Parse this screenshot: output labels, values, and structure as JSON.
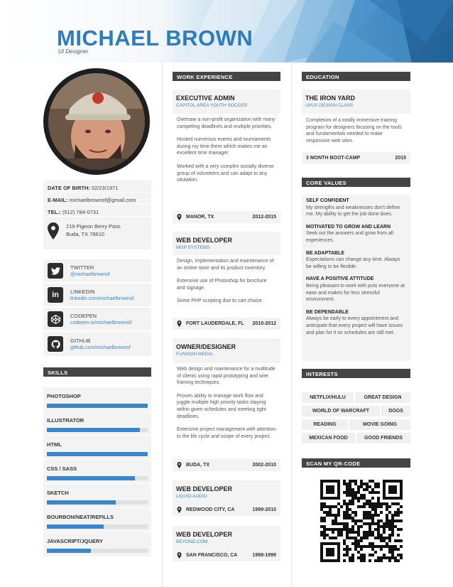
{
  "header": {
    "name": "MICHAEL BROWN",
    "role": "UI Designer"
  },
  "personal": {
    "dob_label": "DATE OF BIRTH:",
    "dob": "02/23/1971",
    "email_label": "E-MAIL:",
    "email": "michaelbrownsf@gmail.com",
    "tel_label": "TEL.:",
    "tel": "(512) 784-0731",
    "address_line1": "219 Pigeon Berry Pass",
    "address_line2": "Buda, TX 78610"
  },
  "social": [
    {
      "name": "TWITTER",
      "handle": "@michaelbrownsf",
      "icon": "twitter-icon"
    },
    {
      "name": "LINKEDIN",
      "handle": "linkedin.com/michaelbrownsf",
      "icon": "linkedin-icon"
    },
    {
      "name": "CODEPEN",
      "handle": "codepen.io/michaelbrownsf/",
      "icon": "codepen-icon"
    },
    {
      "name": "GITHUB",
      "handle": "github.com/michaelbrownsf",
      "icon": "github-icon"
    }
  ],
  "skills_title": "SKILLS",
  "skills": [
    {
      "name": "PHOTOSHOP",
      "level": 1.0
    },
    {
      "name": "ILLUSTRATOR",
      "level": 0.92
    },
    {
      "name": "HTML",
      "level": 1.0
    },
    {
      "name": "CSS / SASS",
      "level": 0.87
    },
    {
      "name": "SKETCH",
      "level": 0.68
    },
    {
      "name": "BOURBON/NEAT/REFILLS",
      "level": 0.56
    },
    {
      "name": "JAVASCRIPT/JQUERY",
      "level": 0.44
    }
  ],
  "work_title": "WORK EXPERIENCE",
  "jobs": [
    {
      "title": "EXECUTIVE ADMIN",
      "company": "CAPITOL AREA YOUTH SOCCER",
      "desc": [
        "Oversaw a non-profit organization with many competing deadlines and multiple priorities.",
        "Hosted numerous events and tournaments during my time there which makes me an excellent time manager.",
        "Worked with a very complex socially diverse group of volunteers and can adapt to any situtation."
      ],
      "location": "MANOR, TX",
      "years": "2012-2015"
    },
    {
      "title": "WEB DEVELOPER",
      "company": "MGP SYSTEMS",
      "desc": [
        "Design, implementation and maintenance of an online store and its product inventory.",
        "Extensive use of Photoshop for brochure and signage.",
        "Some PHP scripting due to cart choice."
      ],
      "location": "FORT LAUDERDALE, FL",
      "years": "2010-2012"
    },
    {
      "title": "OWNER/DESIGNER",
      "company": "FUNXION MEDIA",
      "desc": [
        "Web design and maintenance for a multitude of clients using rapid prototyping and wire framing techniques.",
        "Proven ability to manage work flow and juggle multiple high priority tasks staying within given schedules and meeting tight deadlines.",
        "Extensive project management with attention to the life cycle and scope of every project."
      ],
      "location": "BUDA, TX",
      "years": "2002-2010"
    },
    {
      "title": "WEB DEVELOPER",
      "company": "LIQUID AUDIO",
      "desc": [],
      "location": "REDWOOD CITY, CA",
      "years": "1999-2010"
    },
    {
      "title": "WEB DEVELOPER",
      "company": "BEYOND.COM",
      "desc": [],
      "location": "SAN FRANCISCO, CA",
      "years": "1998-1999"
    }
  ],
  "education_title": "EDUCATION",
  "education": {
    "school": "THE IRON YARD",
    "program": "UI/UX DESIGN CLASS",
    "desc": "Completion of a totally immersive training program for  designers focusing on the tools and fundamentals needed to make responsive web sites.",
    "type": "3 MONTH BOOT-CAMP",
    "year": "2015"
  },
  "core_title": "CORE VALUES",
  "core_values": [
    {
      "h": "SELF CONFIDENT",
      "t": "My strengths and weaknesses don't define me. My ability to get the job done does."
    },
    {
      "h": "MOTIVATED TO GROW AND LEARN",
      "t": "Seek out the answers and grow from all experiences."
    },
    {
      "h": "BE ADAPTABLE",
      "t": "Expectations can change any time. Always be willing to be flexible."
    },
    {
      "h": "HAVE A POSITIVE ATTITUDE",
      "t": "Being pleasant to work with puts everyone at ease and makes for less stressful environment."
    },
    {
      "h": "BE DEPENDABLE",
      "t": "Always be early to every appointment and anticipate that every project will have issues and plan for it so schedules are still met."
    }
  ],
  "interests_title": "INTERESTS",
  "interests": [
    "NETFLIX/HULU",
    "GREAT DESIGN",
    "WORLD OF WARCRAFT",
    "DOGS",
    "READING",
    "MOVIE GOING",
    "MEXICAN FOOD",
    "GOOD FRIENDS"
  ],
  "qr_title": "SCAN MY QR-CODE",
  "colors": {
    "accent": "#2b7cc0",
    "dark": "#444444",
    "panel": "#f3f3f3"
  }
}
